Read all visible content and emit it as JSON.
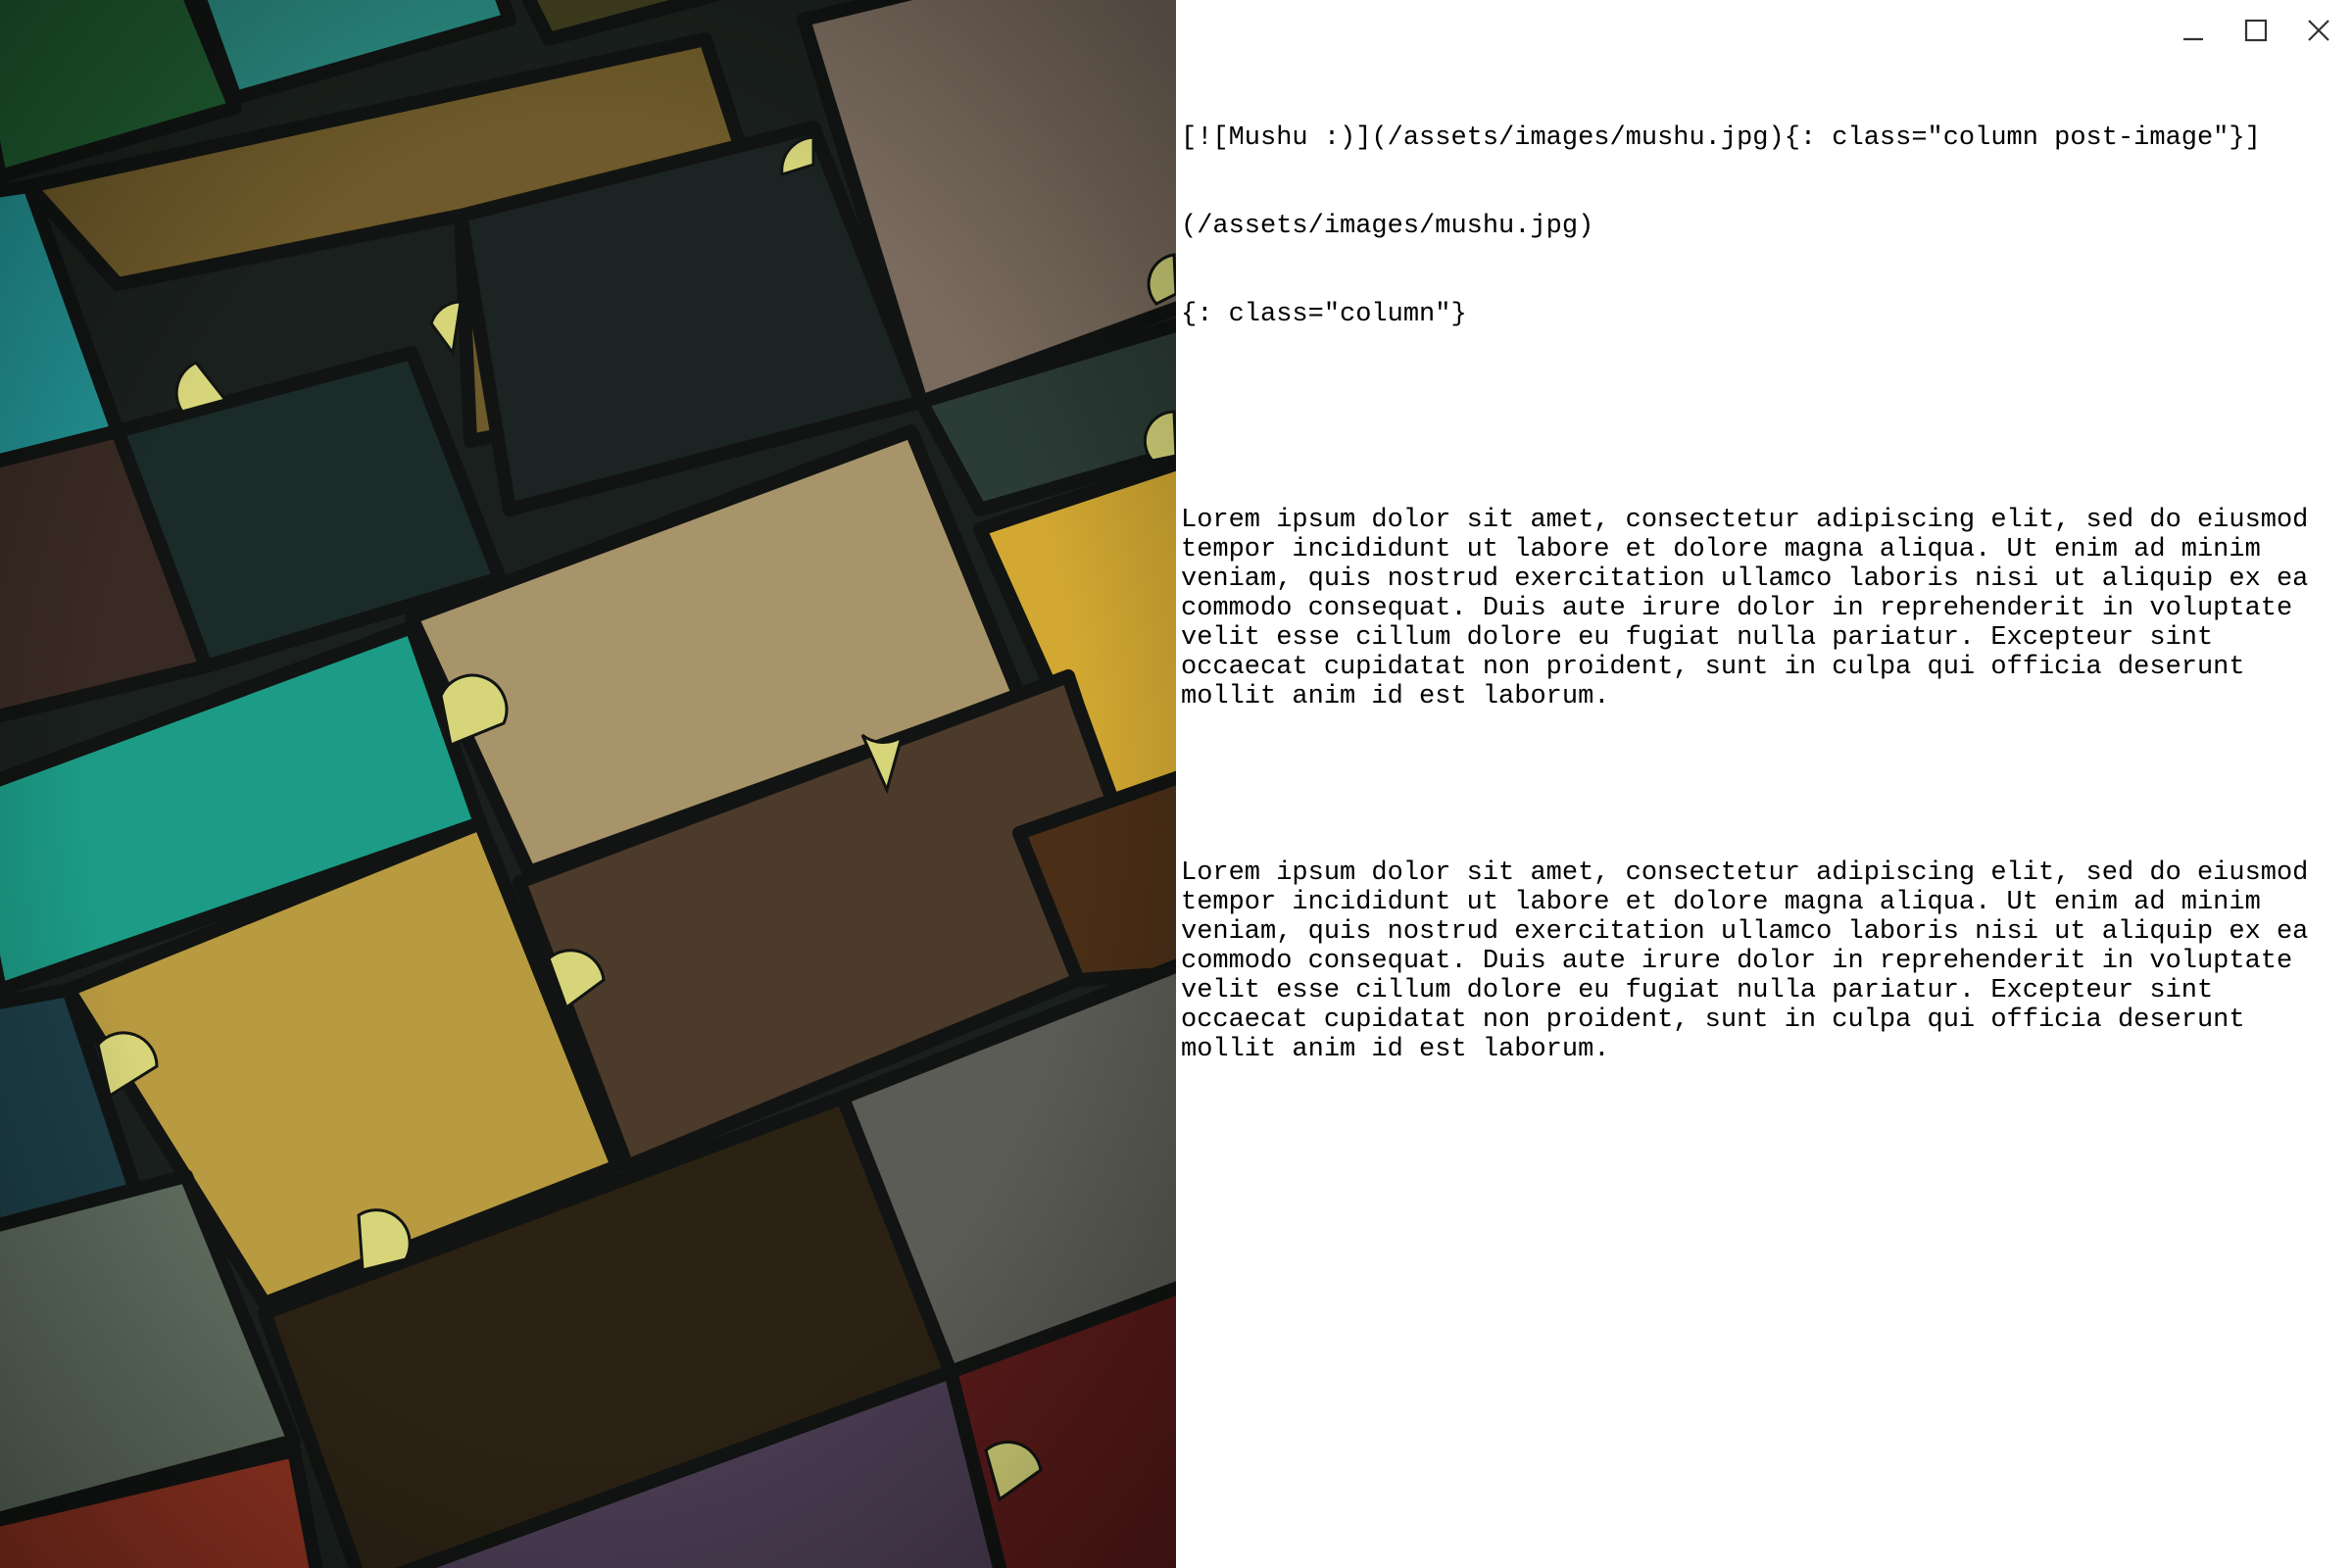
{
  "window": {
    "controls": {
      "minimize": {
        "icon": "minimize-icon"
      },
      "maximize": {
        "icon": "maximize-icon"
      },
      "close": {
        "icon": "close-icon"
      }
    }
  },
  "document": {
    "markdown_lines": [
      "[![Mushu :)](/assets/images/mushu.jpg){: class=\"column post-image\"}]",
      "(/assets/images/mushu.jpg)",
      "{: class=\"column\"}"
    ],
    "paragraphs": [
      "Lorem ipsum dolor sit amet, consectetur adipiscing elit, sed do eiusmod tempor incididunt ut labore et dolore magna aliqua. Ut enim ad minim veniam, quis nostrud exercitation ullamco laboris nisi ut aliquip ex ea commodo consequat. Duis aute irure dolor in reprehenderit in voluptate velit esse cillum dolore eu fugiat nulla pariatur. Excepteur sint occaecat cupidatat non proident, sunt in culpa qui officia deserunt mollit anim id est laborum.",
      "Lorem ipsum dolor sit amet, consectetur adipiscing elit, sed do eiusmod tempor incididunt ut labore et dolore magna aliqua. Ut enim ad minim veniam, quis nostrud exercitation ullamco laboris nisi ut aliquip ex ea commodo consequat. Duis aute irure dolor in reprehenderit in voluptate velit esse cillum dolore eu fugiat nulla pariatur. Excepteur sint occaecat cupidatat non proident, sunt in culpa qui officia deserunt mollit anim id est laborum."
    ]
  },
  "colors": {
    "window_background": "#ffffff",
    "text": "#000000",
    "wallpaper_outline": "#141614",
    "door_marker": "#d6d57a"
  }
}
